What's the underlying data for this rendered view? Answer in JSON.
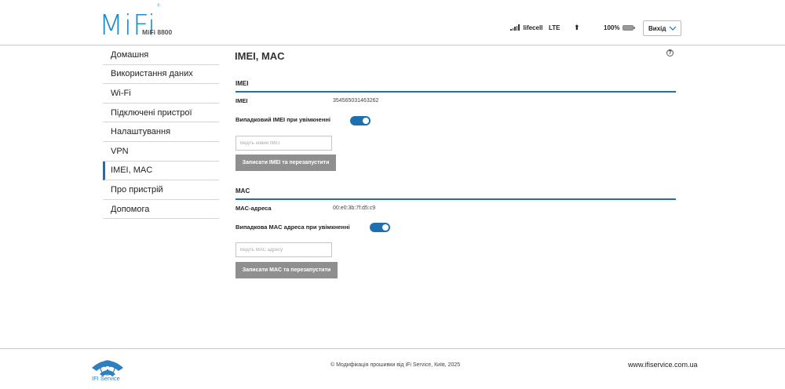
{
  "header": {
    "logo_text": "MiFi",
    "logo_mark": "®",
    "model": "MiFi 8800",
    "operator": "lifecell",
    "network": "LTE",
    "data_arrow": "⬆",
    "battery": "100%",
    "logout_label": "Вихід"
  },
  "sidebar": {
    "items": [
      {
        "label": "Домашня"
      },
      {
        "label": "Використання даних"
      },
      {
        "label": "Wi-Fi"
      },
      {
        "label": "Підключені пристрої"
      },
      {
        "label": "Налаштування"
      },
      {
        "label": "VPN"
      },
      {
        "label": "IMEI, MAC",
        "active": true
      },
      {
        "label": "Про пристрій"
      },
      {
        "label": "Допомога"
      }
    ]
  },
  "main": {
    "title": "IMEI, MAC",
    "help": "?",
    "imei": {
      "heading": "IMEI",
      "label": "IMEI",
      "value": "354565031463262",
      "random_label": "Випадковий IMEI при увімкненні",
      "random_enabled": true,
      "input_placeholder": "Ведіть новий IMEI",
      "button_label": "Записати IMEI та перезапустити"
    },
    "mac": {
      "heading": "MAC",
      "label": "MAC-адреса",
      "value": "00:e0:3b:7f:d5:c9",
      "random_label": "Випадкова MAC адреса при увімкненні",
      "random_enabled": true,
      "input_placeholder": "Ведіть MAC адресу",
      "button_label": "Записати MAC та перезапустити"
    }
  },
  "footer": {
    "logo_text": "IFI Service",
    "copyright": "© Модифікація прошивки від iFi Service, Київ, 2025",
    "site": "www.ifiservice.com.ua"
  },
  "colors": {
    "accent": "#1e6fb0",
    "logo": "#1e8ac8",
    "button_gray": "#8f8f8f"
  }
}
